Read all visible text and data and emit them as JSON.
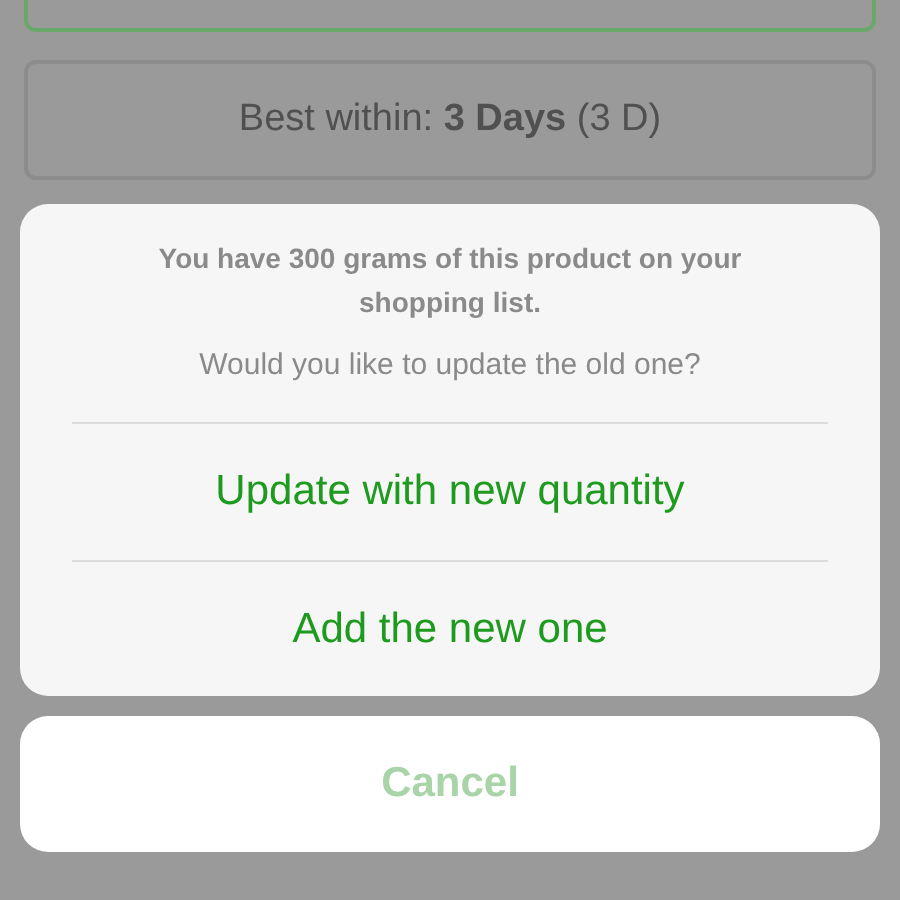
{
  "background": {
    "best_within": "Best within: **3 Days** (3 D)"
  },
  "action_sheet": {
    "message": "You have 300 grams of this product on your shopping list.",
    "question": "Would you like to update the old one?",
    "actions": [
      {
        "label": "Update with new quantity"
      },
      {
        "label": "Add the new one"
      }
    ],
    "cancel": {
      "label": "Cancel"
    }
  }
}
